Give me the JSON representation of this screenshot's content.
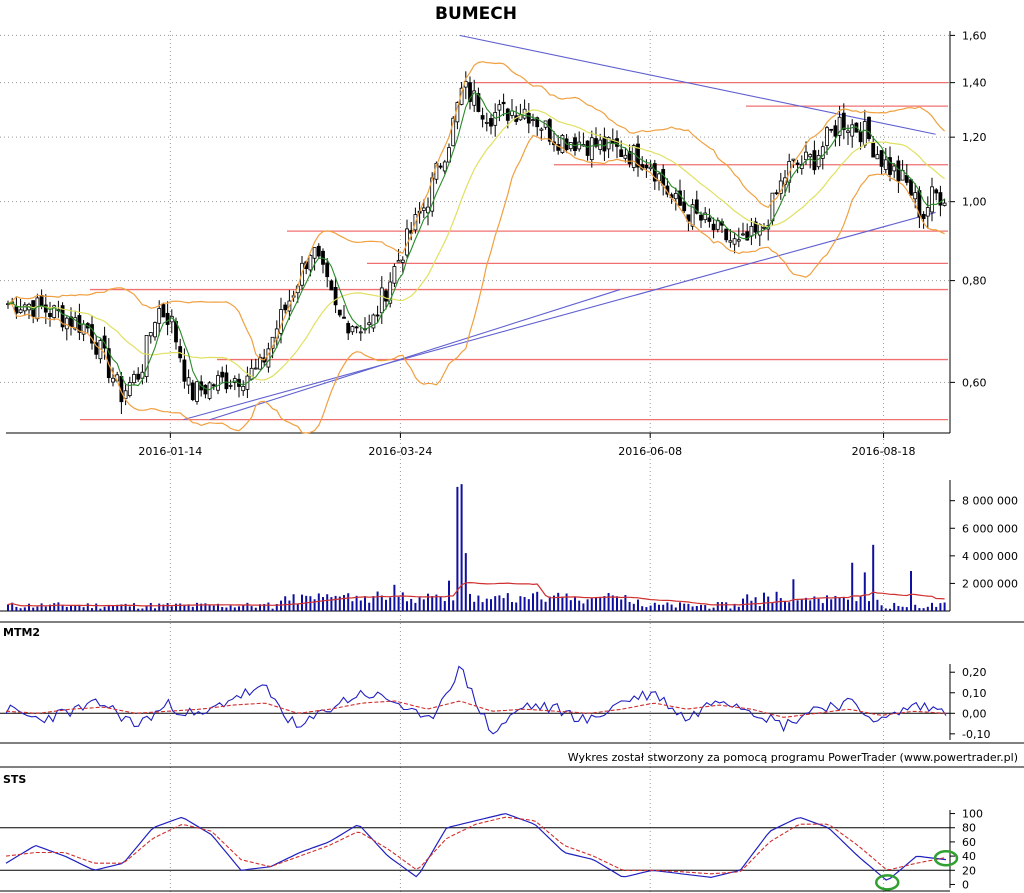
{
  "title": "BUMECH",
  "credit": "Wykres został stworzony za pomocą programu PowerTrader (www.powertrader.pl)",
  "colors": {
    "candle": "#000000",
    "bollinger": "#f0a040",
    "ma_short": "#2a8a2a",
    "ma_long": "#e0e060",
    "support_lines": "#f07070",
    "trend_lines": "#6060d0",
    "volume_bars": "#1010a0",
    "volume_ma": "#d03030",
    "osc_main": "#2020c0",
    "osc_signal": "#d03030",
    "highlight_circle": "#30a030"
  },
  "chart_data": [
    {
      "panel": "price",
      "type": "candlestick",
      "title": "BUMECH",
      "x_tick_labels": [
        "2016-01-14",
        "2016-03-24",
        "2016-06-08",
        "2016-08-18"
      ],
      "y_tick_labels": [
        "0,60",
        "0,80",
        "1,00",
        "1,20",
        "1,40",
        "1,60"
      ],
      "y_ticks": [
        0.6,
        0.8,
        1.0,
        1.2,
        1.4,
        1.6
      ],
      "ylim": [
        0.52,
        1.62
      ],
      "scale": "log",
      "grid": true,
      "indicators": [
        "Bollinger bands",
        "moving average (short)",
        "moving average (long)"
      ],
      "horizontal_levels": [
        1.4,
        1.31,
        1.11,
        0.92,
        0.84,
        0.78,
        0.64,
        0.54
      ],
      "trend_lines": [
        {
          "x": [
            "2016-04-11",
            "2016-09-01"
          ],
          "y": [
            1.6,
            1.21
          ]
        },
        {
          "x": [
            "2016-01-18",
            "2016-09-01"
          ],
          "y": [
            0.54,
            0.97
          ]
        }
      ],
      "close_approx": [
        {
          "x": "2015-12-01",
          "y": 0.75
        },
        {
          "x": "2015-12-10",
          "y": 0.73
        },
        {
          "x": "2015-12-20",
          "y": 0.7
        },
        {
          "x": "2015-12-30",
          "y": 0.58
        },
        {
          "x": "2016-01-05",
          "y": 0.62
        },
        {
          "x": "2016-01-10",
          "y": 0.74
        },
        {
          "x": "2016-01-14",
          "y": 0.72
        },
        {
          "x": "2016-01-20",
          "y": 0.58
        },
        {
          "x": "2016-01-28",
          "y": 0.6
        },
        {
          "x": "2016-02-10",
          "y": 0.62
        },
        {
          "x": "2016-02-20",
          "y": 0.77
        },
        {
          "x": "2016-02-26",
          "y": 0.88
        },
        {
          "x": "2016-03-05",
          "y": 0.72
        },
        {
          "x": "2016-03-15",
          "y": 0.7
        },
        {
          "x": "2016-03-24",
          "y": 0.86
        },
        {
          "x": "2016-04-01",
          "y": 1.0
        },
        {
          "x": "2016-04-08",
          "y": 1.2
        },
        {
          "x": "2016-04-12",
          "y": 1.38
        },
        {
          "x": "2016-04-20",
          "y": 1.28
        },
        {
          "x": "2016-05-01",
          "y": 1.3
        },
        {
          "x": "2016-05-10",
          "y": 1.2
        },
        {
          "x": "2016-05-20",
          "y": 1.18
        },
        {
          "x": "2016-06-01",
          "y": 1.15
        },
        {
          "x": "2016-06-08",
          "y": 1.12
        },
        {
          "x": "2016-06-15",
          "y": 1.0
        },
        {
          "x": "2016-06-25",
          "y": 0.94
        },
        {
          "x": "2016-07-05",
          "y": 0.88
        },
        {
          "x": "2016-07-12",
          "y": 0.92
        },
        {
          "x": "2016-07-20",
          "y": 1.1
        },
        {
          "x": "2016-07-28",
          "y": 1.13
        },
        {
          "x": "2016-08-05",
          "y": 1.26
        },
        {
          "x": "2016-08-12",
          "y": 1.22
        },
        {
          "x": "2016-08-18",
          "y": 1.12
        },
        {
          "x": "2016-08-25",
          "y": 1.05
        },
        {
          "x": "2016-08-30",
          "y": 0.96
        },
        {
          "x": "2016-09-02",
          "y": 1.02
        }
      ]
    },
    {
      "panel": "volume",
      "type": "bar",
      "y_tick_labels": [
        "2 000 000",
        "4 000 000",
        "6 000 000",
        "8 000 000"
      ],
      "y_ticks": [
        2000000,
        4000000,
        6000000,
        8000000
      ],
      "ylim": [
        0,
        9500000
      ],
      "spikes_approx": [
        {
          "x": "2016-04-08",
          "y": 2200000
        },
        {
          "x": "2016-04-11",
          "y": 9000000
        },
        {
          "x": "2016-04-12",
          "y": 9200000
        },
        {
          "x": "2016-04-13",
          "y": 4200000
        },
        {
          "x": "2016-03-22",
          "y": 1900000
        },
        {
          "x": "2016-07-22",
          "y": 2300000
        },
        {
          "x": "2016-08-08",
          "y": 3500000
        },
        {
          "x": "2016-08-12",
          "y": 2800000
        },
        {
          "x": "2016-08-15",
          "y": 4800000
        },
        {
          "x": "2016-08-26",
          "y": 2900000
        }
      ]
    },
    {
      "panel": "MTM2",
      "type": "line",
      "label": "MTM2",
      "y_tick_labels": [
        "-0,10",
        "0,00",
        "0,10",
        "0,20"
      ],
      "y_ticks": [
        -0.1,
        0.0,
        0.1,
        0.2
      ],
      "ylim": [
        -0.13,
        0.24
      ],
      "series": [
        {
          "values_approx": [
            0.02,
            -0.03,
            0.01,
            0.05,
            -0.06,
            0.04,
            -0.02,
            0.08,
            0.12,
            -0.08,
            0.03,
            0.1,
            0.06,
            -0.05,
            0.22,
            -0.1,
            0.04,
            0.02,
            -0.04,
            0.06,
            0.1,
            -0.03,
            0.08,
            0.02,
            -0.06,
            0.03,
            0.05,
            -0.04,
            0.04,
            0.01
          ]
        },
        {
          "values_approx": [
            0.01,
            0.0,
            0.02,
            0.03,
            0.0,
            0.01,
            0.02,
            0.04,
            0.05,
            0.0,
            0.02,
            0.05,
            0.06,
            0.02,
            0.06,
            0.01,
            0.02,
            0.01,
            0.0,
            0.02,
            0.05,
            0.02,
            0.04,
            0.02,
            -0.02,
            0.0,
            0.02,
            -0.01,
            0.01,
            0.0
          ]
        }
      ]
    },
    {
      "panel": "STS",
      "type": "line",
      "label": "STS",
      "y_tick_labels": [
        "0",
        "20",
        "40",
        "60",
        "80",
        "100"
      ],
      "y_ticks": [
        0,
        20,
        40,
        60,
        80,
        100
      ],
      "ylim": [
        -5,
        105
      ],
      "reference_lines": [
        20,
        80
      ],
      "series": [
        {
          "values_approx": [
            30,
            55,
            40,
            20,
            30,
            80,
            95,
            70,
            20,
            25,
            45,
            60,
            85,
            40,
            10,
            80,
            90,
            100,
            85,
            45,
            35,
            10,
            20,
            15,
            10,
            20,
            75,
            95,
            80,
            40,
            5,
            40,
            35
          ]
        },
        {
          "values_approx": [
            40,
            45,
            45,
            30,
            30,
            65,
            85,
            75,
            35,
            25,
            40,
            55,
            75,
            50,
            20,
            65,
            85,
            95,
            90,
            55,
            40,
            20,
            20,
            18,
            15,
            18,
            60,
            85,
            85,
            55,
            20,
            30,
            38
          ]
        }
      ],
      "highlight_circles": [
        {
          "x_index": 30,
          "y": 3
        },
        {
          "x_index": 32,
          "y": 37
        }
      ]
    }
  ]
}
